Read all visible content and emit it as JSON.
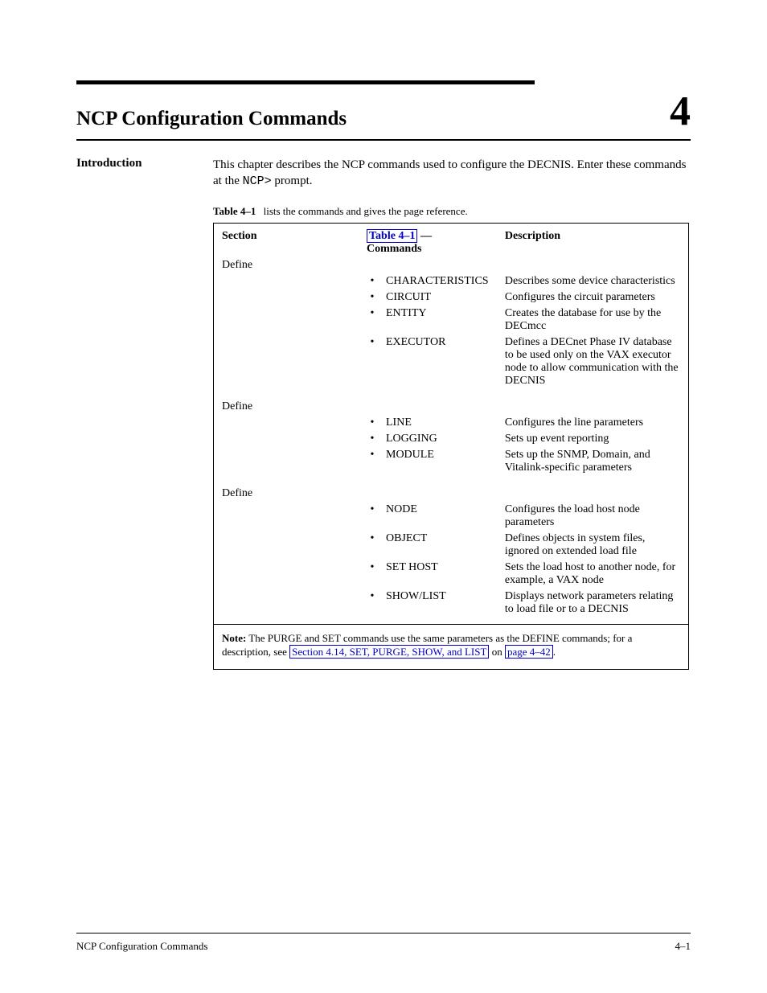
{
  "chapter": {
    "title": "NCP Configuration Commands",
    "number": "4",
    "sideLabel": "Introduction",
    "introPrefix": "This chapter describes the NCP commands used to configure the DECNIS. Enter these commands at the ",
    "introPrompt": "NCP>",
    "introSuffix": " prompt.",
    "tableCaption": {
      "label": "Table 4–1",
      "text": "lists the commands and gives the page reference."
    },
    "tableLinkText": "Table 4–1"
  },
  "table": {
    "headers": [
      "Section",
      "Commands",
      "Description"
    ],
    "groups": [
      {
        "section": "Define",
        "rows": [
          {
            "cmd": "CHARACTERISTICS",
            "desc": "Describes some device characteristics"
          },
          {
            "cmd": "CIRCUIT",
            "desc": "Configures the circuit parameters"
          },
          {
            "cmd": "ENTITY",
            "desc": "Creates the database for use by the DECmcc"
          },
          {
            "cmd": "EXECUTOR",
            "desc": "Defines a DECnet Phase IV database to be used only on the VAX executor node to allow communication with the DECNIS"
          }
        ]
      },
      {
        "section": "Define",
        "rows": [
          {
            "cmd": "LINE",
            "desc": "Configures the line parameters"
          },
          {
            "cmd": "LOGGING",
            "desc": "Sets up event reporting"
          },
          {
            "cmd": "MODULE",
            "desc": "Sets up the SNMP, Domain, and Vitalink-specific parameters"
          }
        ]
      },
      {
        "section": "Define",
        "rows": [
          {
            "cmd": "NODE",
            "desc": "Configures the load host node parameters"
          },
          {
            "cmd": "OBJECT",
            "desc": "Defines objects in system files, ignored on extended load file"
          },
          {
            "cmd": "SET HOST",
            "desc": "Sets the load host to another node, for example, a VAX node"
          },
          {
            "cmd": "SHOW/LIST",
            "desc": "Displays network parameters relating to load file or to a DECNIS"
          }
        ]
      }
    ],
    "note": {
      "label": "Note:",
      "textBefore": "The PURGE and SET commands use the same parameters as the DEFINE commands; for a description, see ",
      "linkText": "Section 4.14, SET, PURGE, SHOW, and LIST",
      "textMiddle": " on ",
      "pageLinkText": "page 4–42",
      "textAfter": "."
    }
  },
  "footer": {
    "left": "NCP Configuration Commands",
    "right": "4–1"
  }
}
